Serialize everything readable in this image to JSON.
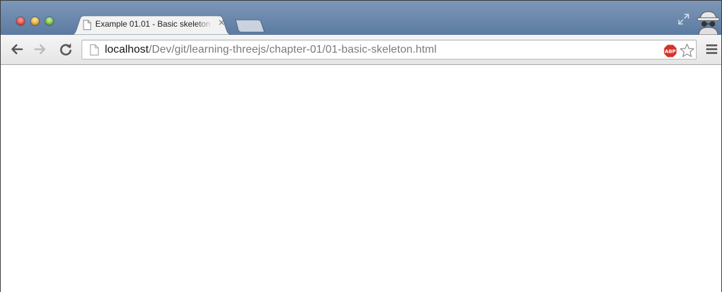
{
  "window": {
    "controls": [
      "close",
      "minimize",
      "zoom"
    ]
  },
  "tabs": [
    {
      "title": "Example 01.01 - Basic skeleton",
      "active": true,
      "icon": "page-icon",
      "close_glyph": "×"
    }
  ],
  "toolbar": {
    "back_icon": "back-arrow-icon",
    "forward_icon": "forward-arrow-icon",
    "reload_icon": "reload-icon",
    "menu_icon": "hamburger-menu-icon"
  },
  "address_bar": {
    "host": "localhost",
    "path": "/Dev/git/learning-threejs/chapter-01/01-basic-skeleton.html",
    "page_icon": "page-icon"
  },
  "extensions": {
    "adblock_label": "ABP",
    "bookmark_icon": "star-icon"
  },
  "colors": {
    "tabstrip": "#6683a9",
    "toolbar": "#ececec",
    "adblock_red": "#d4342b",
    "content_background": "#ffffff"
  }
}
